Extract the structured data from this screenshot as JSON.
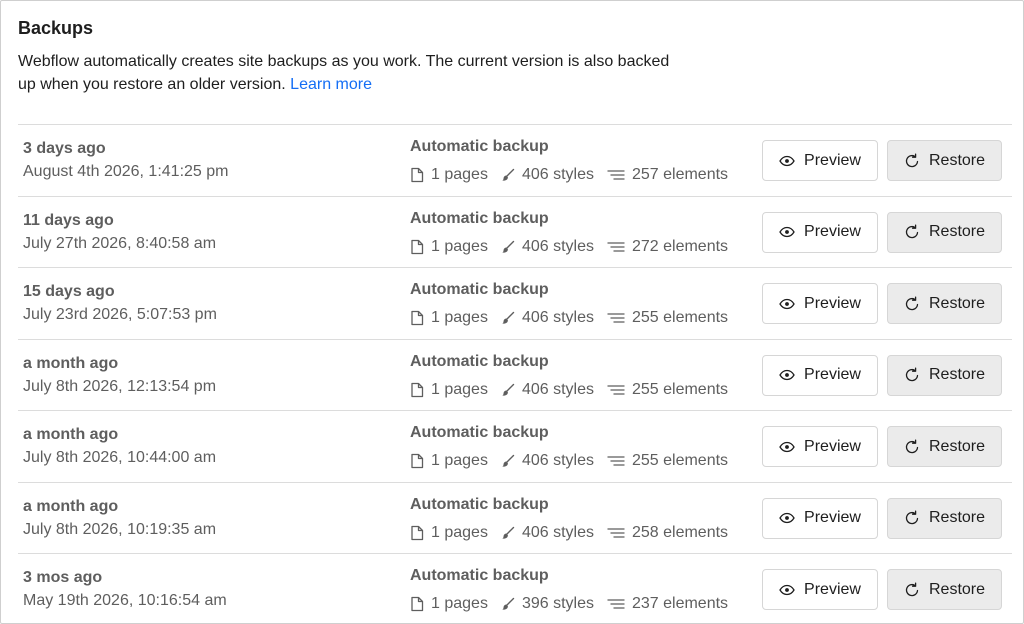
{
  "header": {
    "title": "Backups",
    "description": "Webflow automatically creates site backups as you work. The current version is also backed up when you restore an older version.",
    "learn_more": "Learn more"
  },
  "buttons": {
    "preview": "Preview",
    "restore": "Restore"
  },
  "backups": [
    {
      "relative": "3 days ago",
      "date": "August 4th 2026, 1:41:25 pm",
      "type": "Automatic backup",
      "pages": "1 pages",
      "styles": "406 styles",
      "elements": "257 elements"
    },
    {
      "relative": "11 days ago",
      "date": "July 27th 2026, 8:40:58 am",
      "type": "Automatic backup",
      "pages": "1 pages",
      "styles": "406 styles",
      "elements": "272 elements"
    },
    {
      "relative": "15 days ago",
      "date": "July 23rd 2026, 5:07:53 pm",
      "type": "Automatic backup",
      "pages": "1 pages",
      "styles": "406 styles",
      "elements": "255 elements"
    },
    {
      "relative": "a month ago",
      "date": "July 8th 2026, 12:13:54 pm",
      "type": "Automatic backup",
      "pages": "1 pages",
      "styles": "406 styles",
      "elements": "255 elements"
    },
    {
      "relative": "a month ago",
      "date": "July 8th 2026, 10:44:00 am",
      "type": "Automatic backup",
      "pages": "1 pages",
      "styles": "406 styles",
      "elements": "255 elements"
    },
    {
      "relative": "a month ago",
      "date": "July 8th 2026, 10:19:35 am",
      "type": "Automatic backup",
      "pages": "1 pages",
      "styles": "406 styles",
      "elements": "258 elements"
    },
    {
      "relative": "3 mos ago",
      "date": "May 19th 2026, 10:16:54 am",
      "type": "Automatic backup",
      "pages": "1 pages",
      "styles": "396 styles",
      "elements": "237 elements"
    }
  ],
  "icons": {
    "pages": "page-icon",
    "styles": "brush-icon",
    "elements": "elements-icon",
    "preview": "eye-icon",
    "restore": "restore-icon"
  },
  "colors": {
    "link": "#146ef5",
    "muted_text": "#5e5e5e",
    "restore_bg": "#ebebeb"
  }
}
